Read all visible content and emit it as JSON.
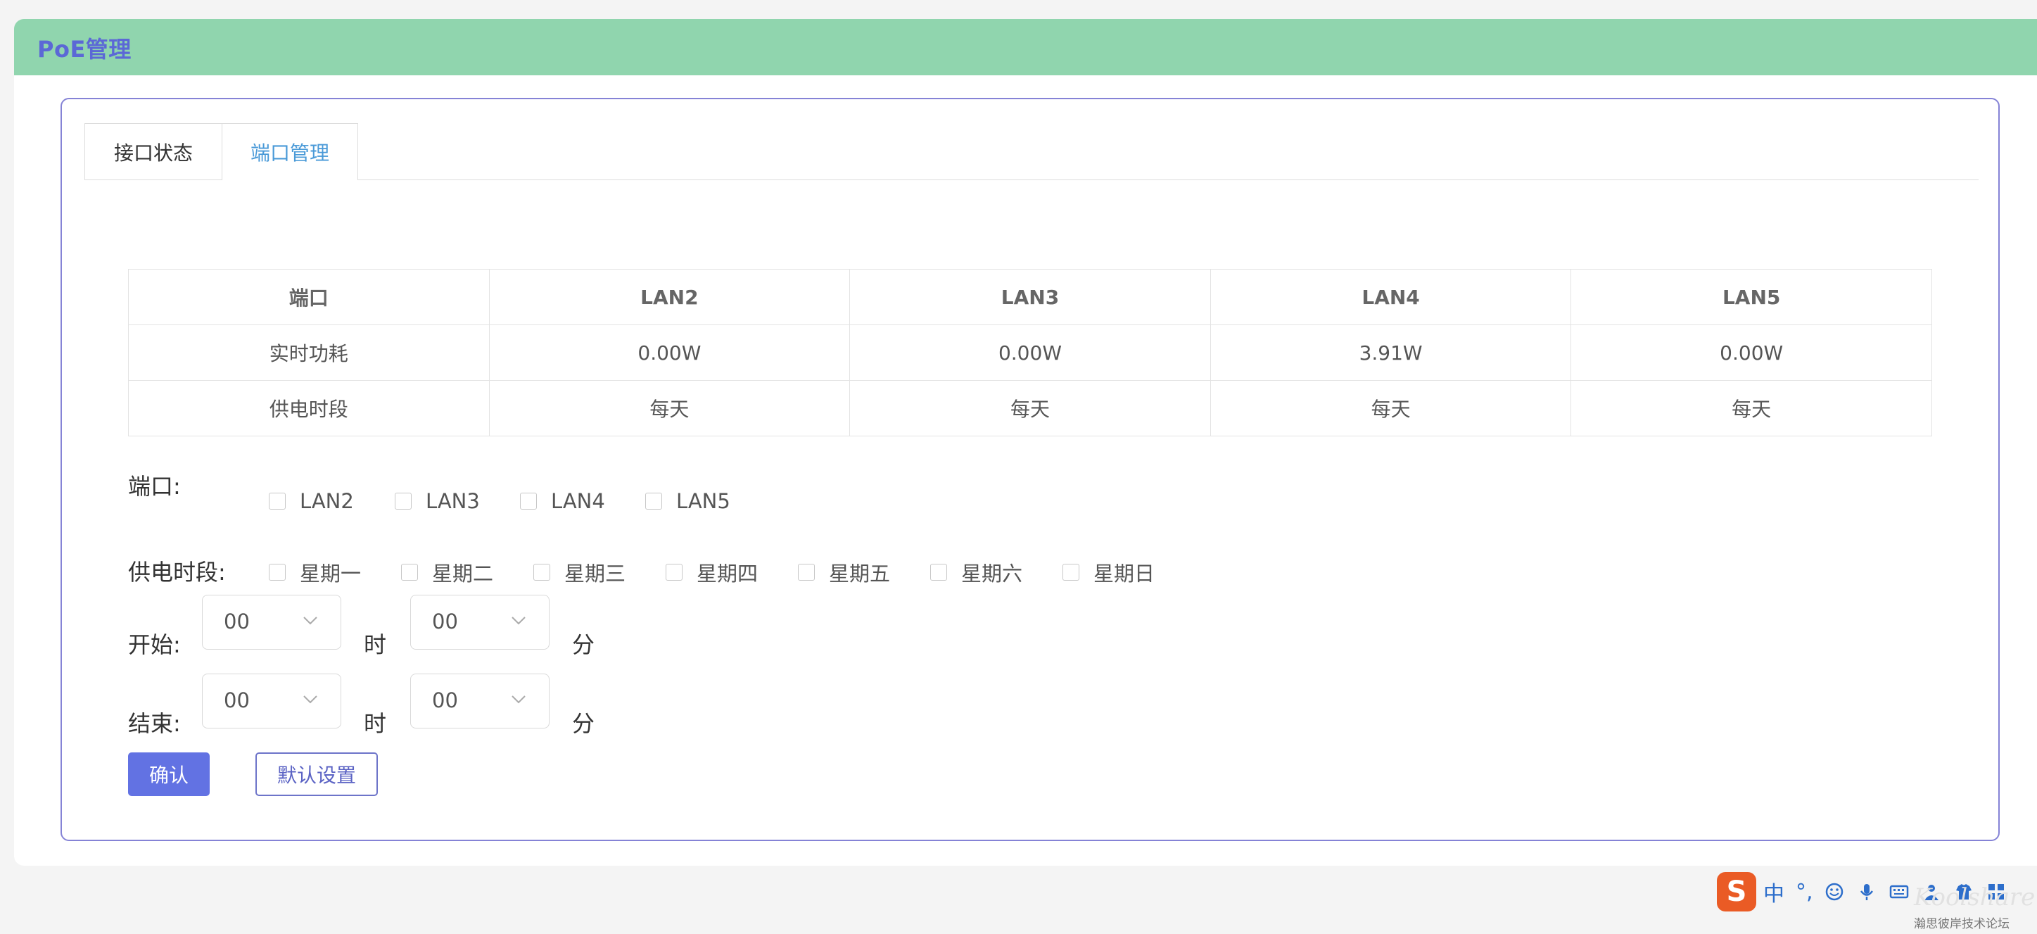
{
  "header": {
    "title": "PoE管理"
  },
  "tabs": [
    {
      "label": "接口状态",
      "active": false
    },
    {
      "label": "端口管理",
      "active": true
    }
  ],
  "table": {
    "header": [
      "端口",
      "LAN2",
      "LAN3",
      "LAN4",
      "LAN5"
    ],
    "rows": [
      [
        "实时功耗",
        "0.00W",
        "0.00W",
        "3.91W",
        "0.00W"
      ],
      [
        "供电时段",
        "每天",
        "每天",
        "每天",
        "每天"
      ]
    ]
  },
  "form": {
    "port_label": "端口:",
    "ports": [
      "LAN2",
      "LAN3",
      "LAN4",
      "LAN5"
    ],
    "schedule_label": "供电时段:",
    "days": [
      "星期一",
      "星期二",
      "星期三",
      "星期四",
      "星期五",
      "星期六",
      "星期日"
    ],
    "start_label": "开始:",
    "end_label": "结束:",
    "hour_unit": "时",
    "minute_unit": "分",
    "start_hour": "00",
    "start_minute": "00",
    "end_hour": "00",
    "end_minute": "00",
    "confirm_label": "确认",
    "default_label": "默认设置"
  },
  "ime": {
    "logo": "S",
    "mode": "中",
    "punct": "°,"
  },
  "watermark": {
    "brand": "Koolshare",
    "sub": "瀚思彼岸技术论坛"
  },
  "colors": {
    "header": "#90d5ae",
    "accent": "#5b68d6",
    "active_tab": "#4a9ad8",
    "confirm": "#6272e3"
  }
}
